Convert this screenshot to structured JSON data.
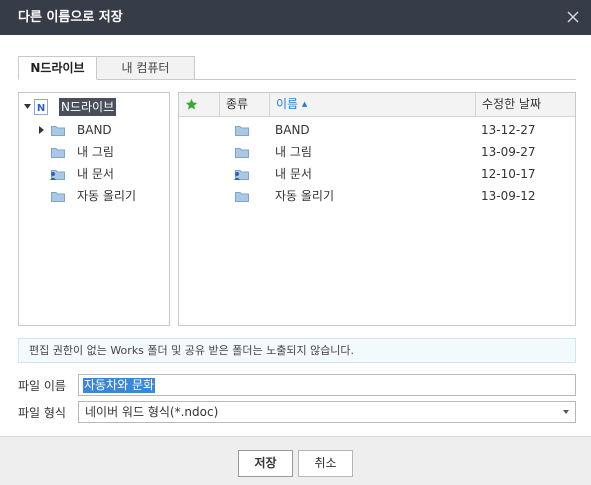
{
  "dialog": {
    "title": "다른 이름으로 저장"
  },
  "tabs": [
    {
      "label": "N드라이브",
      "active": true
    },
    {
      "label": "내 컴퓨터",
      "active": false
    }
  ],
  "tree": {
    "root": {
      "label": "N드라이브",
      "expanded": true
    },
    "items": [
      {
        "label": "BAND",
        "expandable": true,
        "icon": "folder-icon"
      },
      {
        "label": "내 그림",
        "expandable": false,
        "icon": "folder-icon"
      },
      {
        "label": "내 문서",
        "expandable": false,
        "icon": "locked-folder-icon"
      },
      {
        "label": "자동 올리기",
        "expandable": false,
        "icon": "folder-icon"
      }
    ]
  },
  "file_list": {
    "columns": {
      "type": "종류",
      "name": "이름",
      "modified": "수정한 날짜"
    },
    "sort_indicator": "▲",
    "rows": [
      {
        "icon": "folder-icon",
        "name": "BAND",
        "date": "13-12-27"
      },
      {
        "icon": "folder-icon",
        "name": "내 그림",
        "date": "13-09-27"
      },
      {
        "icon": "locked-folder-icon",
        "name": "내 문서",
        "date": "12-10-17"
      },
      {
        "icon": "folder-icon",
        "name": "자동 올리기",
        "date": "13-09-12"
      }
    ]
  },
  "notice": "편집 권한이 없는 Works 폴더 및 공유 받은 폴더는 노출되지 않습니다.",
  "form": {
    "filename_label": "파일 이름",
    "filename_value": "자동차와 문화",
    "format_label": "파일 형식",
    "format_value": "네이버 워드 형식(*.ndoc)"
  },
  "buttons": {
    "save": "저장",
    "cancel": "취소"
  },
  "colors": {
    "titlebar": "#373d48",
    "accent": "#2a7bd5",
    "selection": "#3d86d6",
    "star": "#3aa832",
    "folder": "#9fc3e3"
  }
}
